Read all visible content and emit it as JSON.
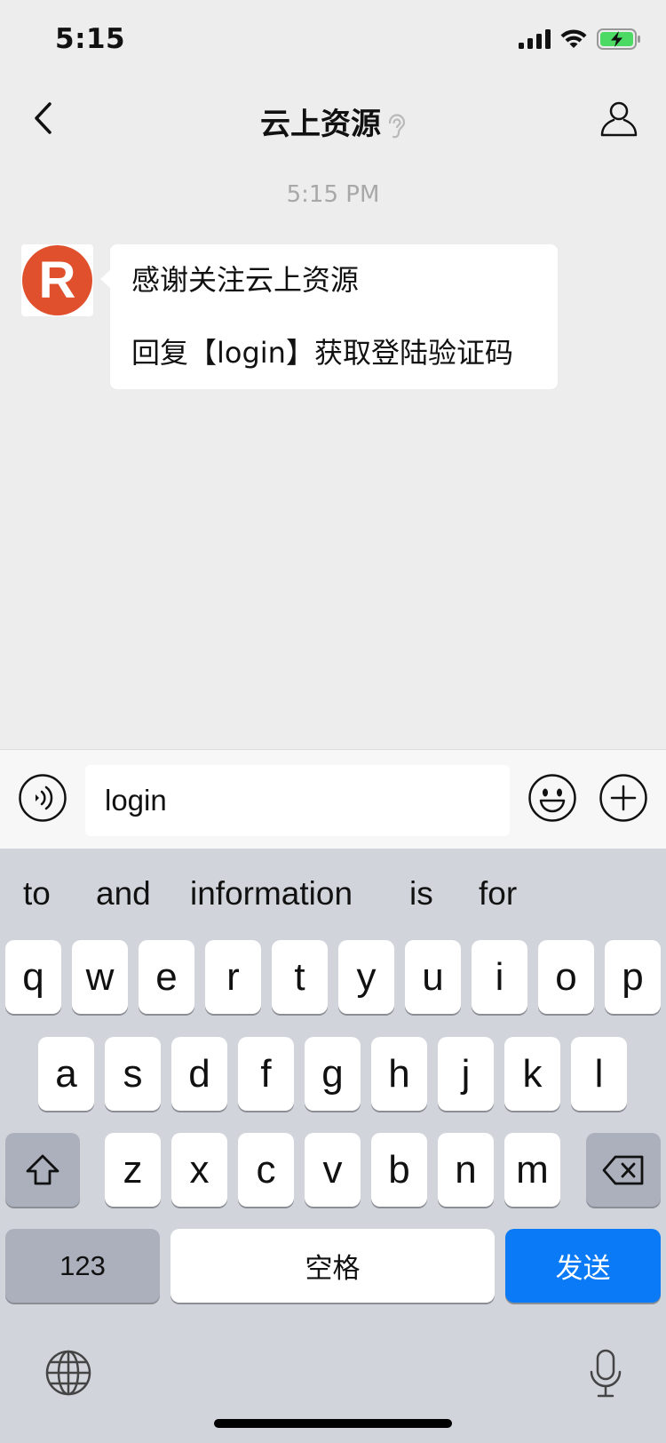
{
  "status_bar": {
    "time": "5:15"
  },
  "nav": {
    "title": "云上资源"
  },
  "chat": {
    "timestamp": "5:15 PM",
    "avatar_letter": "R",
    "message_lines": [
      "感谢关注云上资源",
      "回复【login】获取登陆验证码"
    ]
  },
  "input": {
    "value": "login"
  },
  "keyboard": {
    "suggestions": [
      "to",
      "and",
      "information",
      "is",
      "for"
    ],
    "row1": [
      "q",
      "w",
      "e",
      "r",
      "t",
      "y",
      "u",
      "i",
      "o",
      "p"
    ],
    "row2": [
      "a",
      "s",
      "d",
      "f",
      "g",
      "h",
      "j",
      "k",
      "l"
    ],
    "row3": [
      "z",
      "x",
      "c",
      "v",
      "b",
      "n",
      "m"
    ],
    "num_key": "123",
    "space_key": "空格",
    "send_key": "发送"
  },
  "colors": {
    "send": "#0a7af6",
    "avatar": "#e0502d",
    "background": "#ededed",
    "keyboard": "#d1d4db"
  }
}
